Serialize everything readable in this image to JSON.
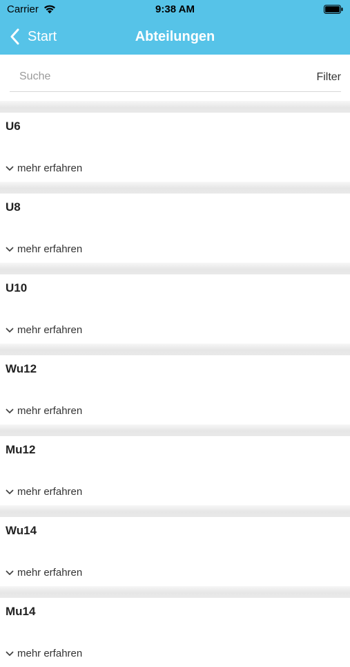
{
  "status_bar": {
    "carrier": "Carrier",
    "time": "9:38 AM"
  },
  "nav": {
    "back_label": "Start",
    "title": "Abteilungen"
  },
  "search": {
    "placeholder": "Suche",
    "filter_label": "Filter"
  },
  "list": {
    "items": [
      {
        "title": "U6",
        "more_label": "mehr erfahren"
      },
      {
        "title": "U8",
        "more_label": "mehr erfahren"
      },
      {
        "title": "U10",
        "more_label": "mehr erfahren"
      },
      {
        "title": "Wu12",
        "more_label": "mehr erfahren"
      },
      {
        "title": "Mu12",
        "more_label": "mehr erfahren"
      },
      {
        "title": "Wu14",
        "more_label": "mehr erfahren"
      },
      {
        "title": "Mu14",
        "more_label": "mehr erfahren"
      }
    ]
  },
  "colors": {
    "header_background": "#56c3e8",
    "header_text": "#ffffff",
    "divider": "#e6e6e6"
  },
  "icons": [
    "wifi-icon",
    "battery-icon",
    "back-chevron-icon",
    "chevron-down-icon"
  ]
}
